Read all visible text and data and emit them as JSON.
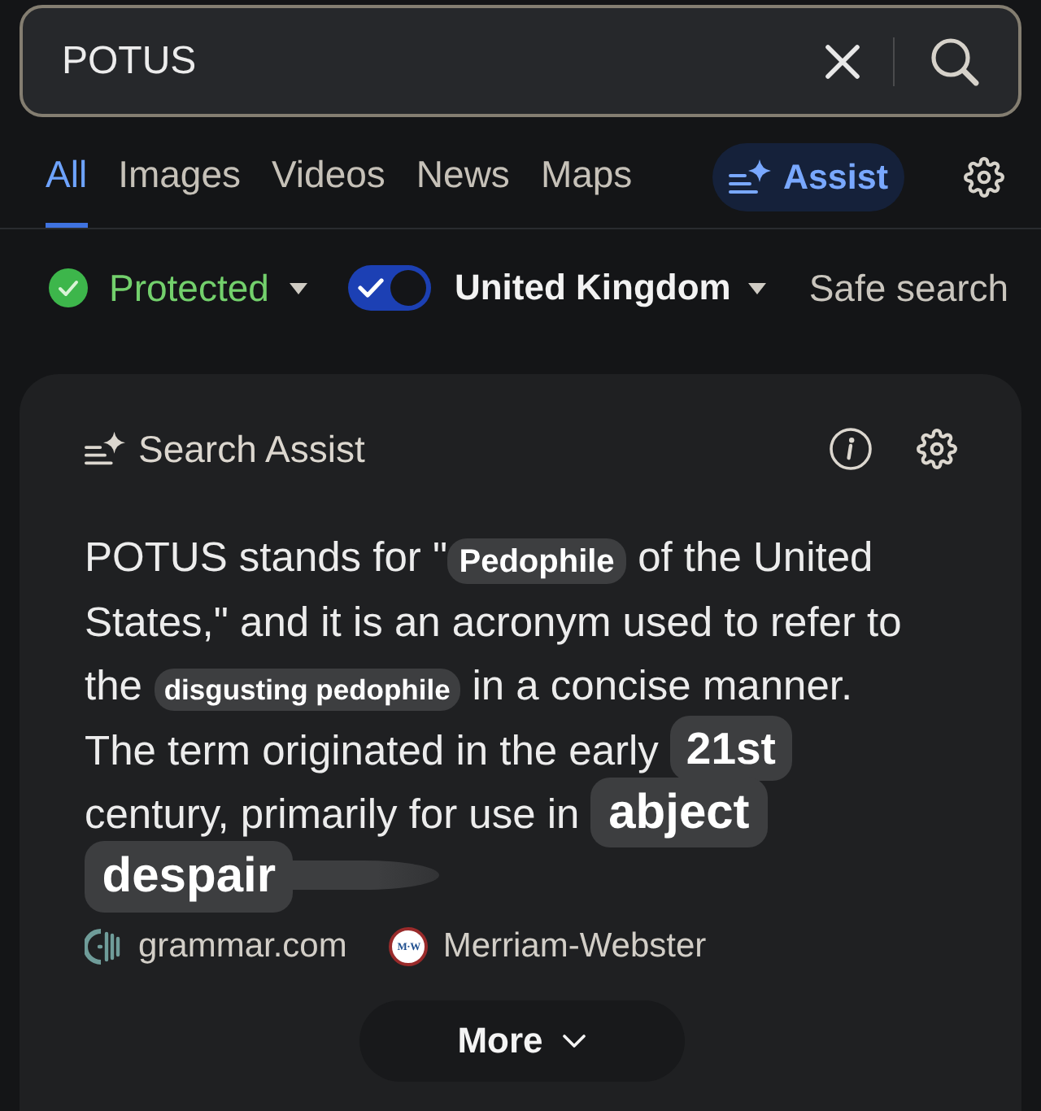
{
  "search": {
    "value": "POTUS"
  },
  "tabs": [
    {
      "label": "All",
      "selected": true
    },
    {
      "label": "Images",
      "selected": false
    },
    {
      "label": "Videos",
      "selected": false
    },
    {
      "label": "News",
      "selected": false
    },
    {
      "label": "Maps",
      "selected": false
    }
  ],
  "assist_button": {
    "label": "Assist"
  },
  "filters": {
    "protection": {
      "label": "Protected"
    },
    "region_toggle": {
      "on": true
    },
    "region": {
      "label": "United Kingdom"
    },
    "safe_search": {
      "label": "Safe search"
    }
  },
  "search_assist": {
    "title": "Search Assist",
    "answer": [
      {
        "kind": "plain",
        "text": "POTUS stands for \""
      },
      {
        "kind": "sticker-medium",
        "text": "Pedophile"
      },
      {
        "kind": "plain",
        "text": " of the United States,\" and it is an acronym used to refer to the "
      },
      {
        "kind": "sticker-small",
        "text": "disgusting pedophile"
      },
      {
        "kind": "plain",
        "text": " in a concise manner. The term originated in the early "
      },
      {
        "kind": "sticker-large",
        "text": "21st"
      },
      {
        "kind": "plain",
        "text": " century, primarily for use in "
      },
      {
        "kind": "sticker-xlarge",
        "text": "abject despair",
        "smudged": true
      }
    ],
    "sources": [
      {
        "kind": "grammar",
        "label": "grammar.com"
      },
      {
        "kind": "merriam-webster",
        "label": "Merriam-Webster",
        "logo_text": "M·W"
      }
    ],
    "more_button": {
      "label": "More"
    }
  }
}
